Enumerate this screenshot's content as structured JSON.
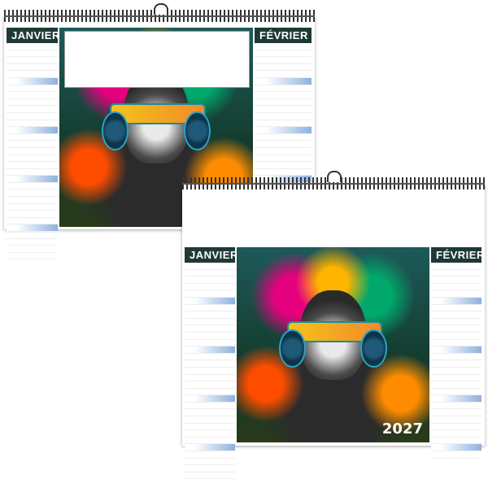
{
  "calendar_back": {
    "left_month": "JANVIER",
    "right_month": "FÉVRIER"
  },
  "calendar_front": {
    "left_month": "JANVIER",
    "right_month": "FÉVRIER",
    "year": "2027"
  },
  "colors": {
    "header_bg": "#1f3a36",
    "weekend_red": "#cc0000",
    "highlight": "#8db1de"
  }
}
